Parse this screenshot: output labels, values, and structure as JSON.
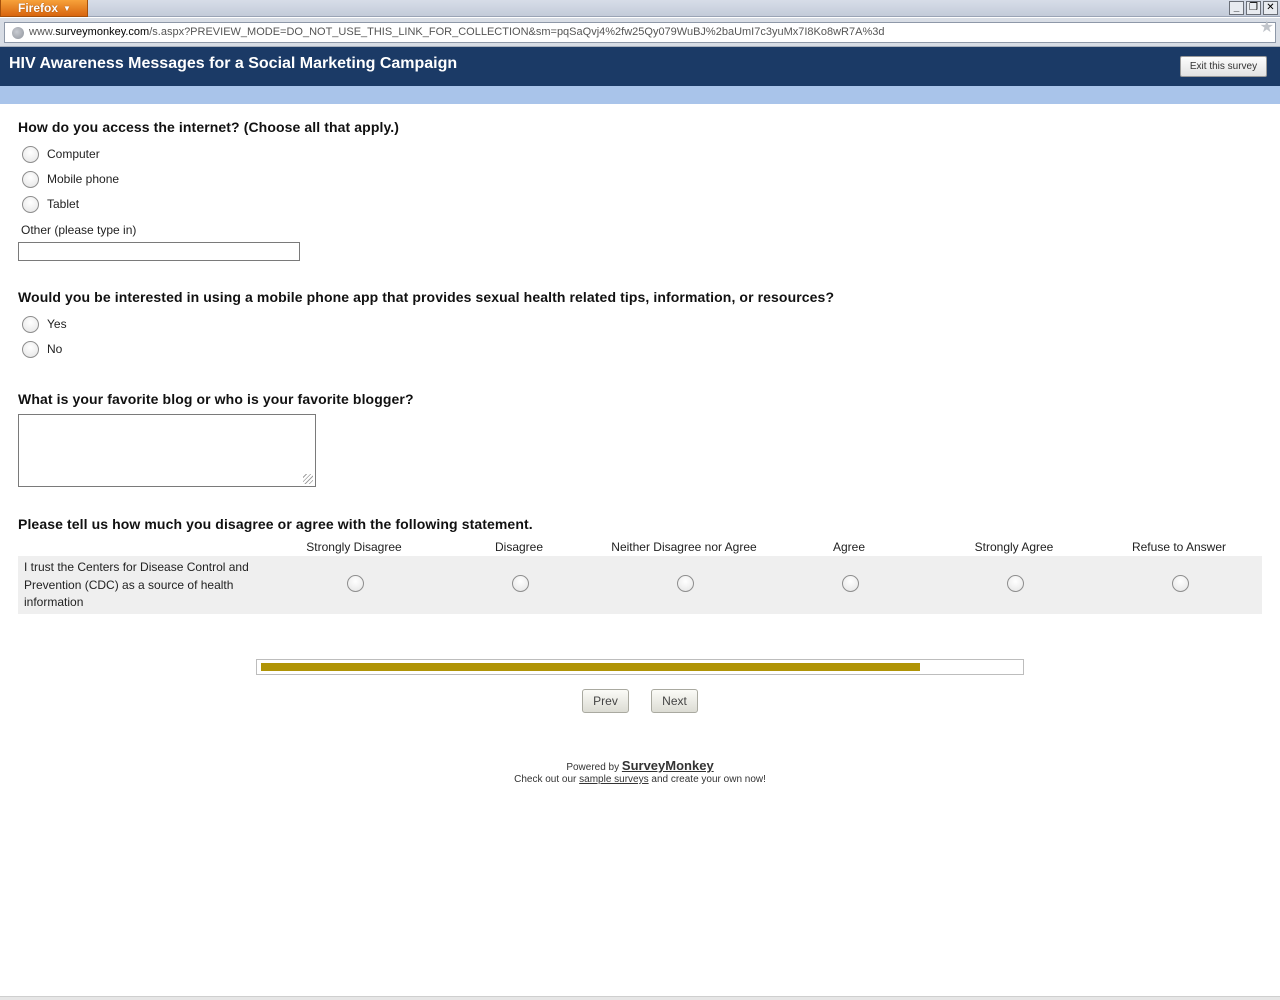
{
  "browser": {
    "menu_label": "Firefox",
    "url_prefix": "www.",
    "url_domain": "surveymonkey.com",
    "url_rest": "/s.aspx?PREVIEW_MODE=DO_NOT_USE_THIS_LINK_FOR_COLLECTION&sm=pqSaQvj4%2fw25Qy079WuBJ%2baUmI7c3yuMx7I8Ko8wR7A%3d",
    "controls": [
      "_",
      "❐",
      "✕"
    ]
  },
  "header": {
    "title": "HIV Awareness Messages for a Social Marketing Campaign",
    "exit_label": "Exit this survey"
  },
  "q1": {
    "title": "How do you access the internet? (Choose all that apply.)",
    "options": [
      "Computer",
      "Mobile phone",
      "Tablet"
    ],
    "other_label": "Other (please type in)",
    "other_value": ""
  },
  "q2": {
    "title": "Would you be interested in using a mobile phone app that provides sexual health related tips, information, or resources?",
    "options": [
      "Yes",
      "No"
    ]
  },
  "q3": {
    "title": "What is your favorite blog or who is your favorite blogger?",
    "value": ""
  },
  "q4": {
    "title": "Please tell us how much you disagree or agree with the following statement.",
    "columns": [
      "Strongly Disagree",
      "Disagree",
      "Neither Disagree nor Agree",
      "Agree",
      "Strongly Agree",
      "Refuse to Answer"
    ],
    "row_label": "I trust the Centers for Disease Control and Prevention (CDC) as a source of health information"
  },
  "progress": {
    "fraction": 0.87
  },
  "nav": {
    "prev_label": "Prev",
    "next_label": "Next"
  },
  "footer": {
    "powered_by": "Powered by",
    "brand": "SurveyMonkey",
    "check_out": "Check out our",
    "sample_link": "sample surveys",
    "create": "and create your own now!"
  },
  "colors": {
    "header_bg": "#1b3a66",
    "band": "#a9c4ea",
    "progress_fill": "#b09406"
  }
}
